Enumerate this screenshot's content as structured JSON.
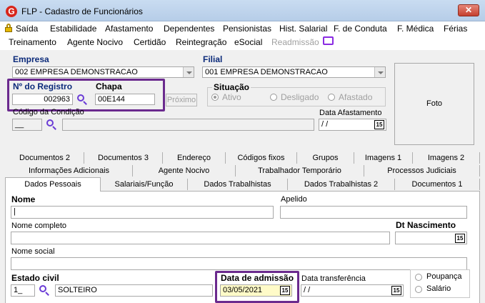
{
  "window": {
    "title": "FLP - Cadastro de Funcionários",
    "close_glyph": "✕",
    "icon_letter": "G"
  },
  "menu": {
    "row1": [
      "Saída",
      "Estabilidade",
      "Afastamento",
      "Dependentes",
      "Pensionistas",
      "Hist. Salarial",
      "F. de Conduta",
      "F. Médica",
      "Férias"
    ],
    "row2": [
      "Treinamento",
      "Agente Nocivo",
      "Certidão",
      "Reintegração",
      "eSocial",
      "Readmissão"
    ]
  },
  "header": {
    "empresa_label": "Empresa",
    "empresa_value": "002 EMPRESA DEMONSTRACAO",
    "filial_label": "Filial",
    "filial_value": "001 EMPRESA DEMONSTRACAO",
    "registro_label": "Nº do Registro",
    "registro_value": "002963",
    "chapa_label": "Chapa",
    "chapa_value": "00E144",
    "proximo_label": "Próximo",
    "situacao_label": "Situação",
    "situacao_options": [
      "Ativo",
      "Desligado",
      "Afastado"
    ],
    "condicao_label": "Código da Condição",
    "condicao_value": "__",
    "data_afastamento_label": "Data Afastamento",
    "data_afastamento_value": "/ /",
    "foto_label": "Foto",
    "calendar_glyph": "15"
  },
  "tabs": {
    "row1": [
      "Documentos 2",
      "Documentos 3",
      "Endereço",
      "Códigos fixos",
      "Grupos",
      "Imagens 1",
      "Imagens 2"
    ],
    "row2": [
      "Informações Adicionais",
      "Agente Nocivo",
      "Trabalhador Temporário",
      "Processos Judiciais"
    ],
    "row3": [
      "Dados Pessoais",
      "Salariais/Função",
      "Dados Trabalhistas",
      "Dados Trabalhistas 2",
      "Documentos 1"
    ]
  },
  "form": {
    "nome_label": "Nome",
    "nome_value": "|",
    "apelido_label": "Apelido",
    "apelido_value": "",
    "nome_completo_label": "Nome completo",
    "dt_nascimento_label": "Dt Nascimento",
    "nome_social_label": "Nome social",
    "estado_civil_label": "Estado civil",
    "estado_civil_code": "1_",
    "estado_civil_desc": "SOLTEIRO",
    "data_admissao_label": "Data de admissão",
    "data_admissao_value": "03/05/2021",
    "data_transferencia_label": "Data transferência",
    "data_transferencia_value": "/ /",
    "conta_options": [
      "Poupança",
      "Salário"
    ]
  }
}
